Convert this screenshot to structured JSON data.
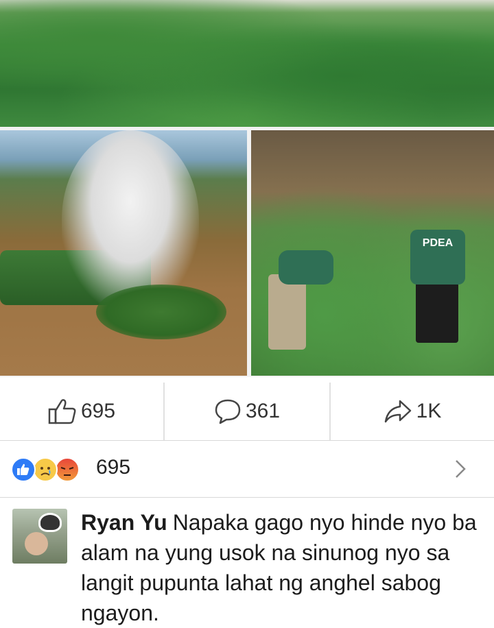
{
  "post": {
    "photos": [
      {
        "name": "top-photo"
      },
      {
        "name": "left-photo"
      },
      {
        "name": "right-photo",
        "shirt_text": "PDEA"
      }
    ]
  },
  "actions": {
    "like": {
      "icon": "thumbs-up-outline-icon",
      "count": "695"
    },
    "comment": {
      "icon": "speech-bubble-icon",
      "count": "361"
    },
    "share": {
      "icon": "share-arrow-icon",
      "count": "1K"
    }
  },
  "reactions": {
    "icons": [
      "like-reaction-icon",
      "sad-reaction-icon",
      "angry-reaction-icon"
    ],
    "count": "695",
    "chevron": "chevron-right-icon"
  },
  "comment": {
    "author": "Ryan Yu",
    "text": "Napaka gago nyo hinde nyo ba alam na yung usok na sinunog nyo sa langit  pupunta lahat ng anghel sabog ngayon."
  },
  "colors": {
    "like_blue": "#2e7bf6",
    "divider": "#d8d8d8",
    "text": "#1c1c1c"
  }
}
